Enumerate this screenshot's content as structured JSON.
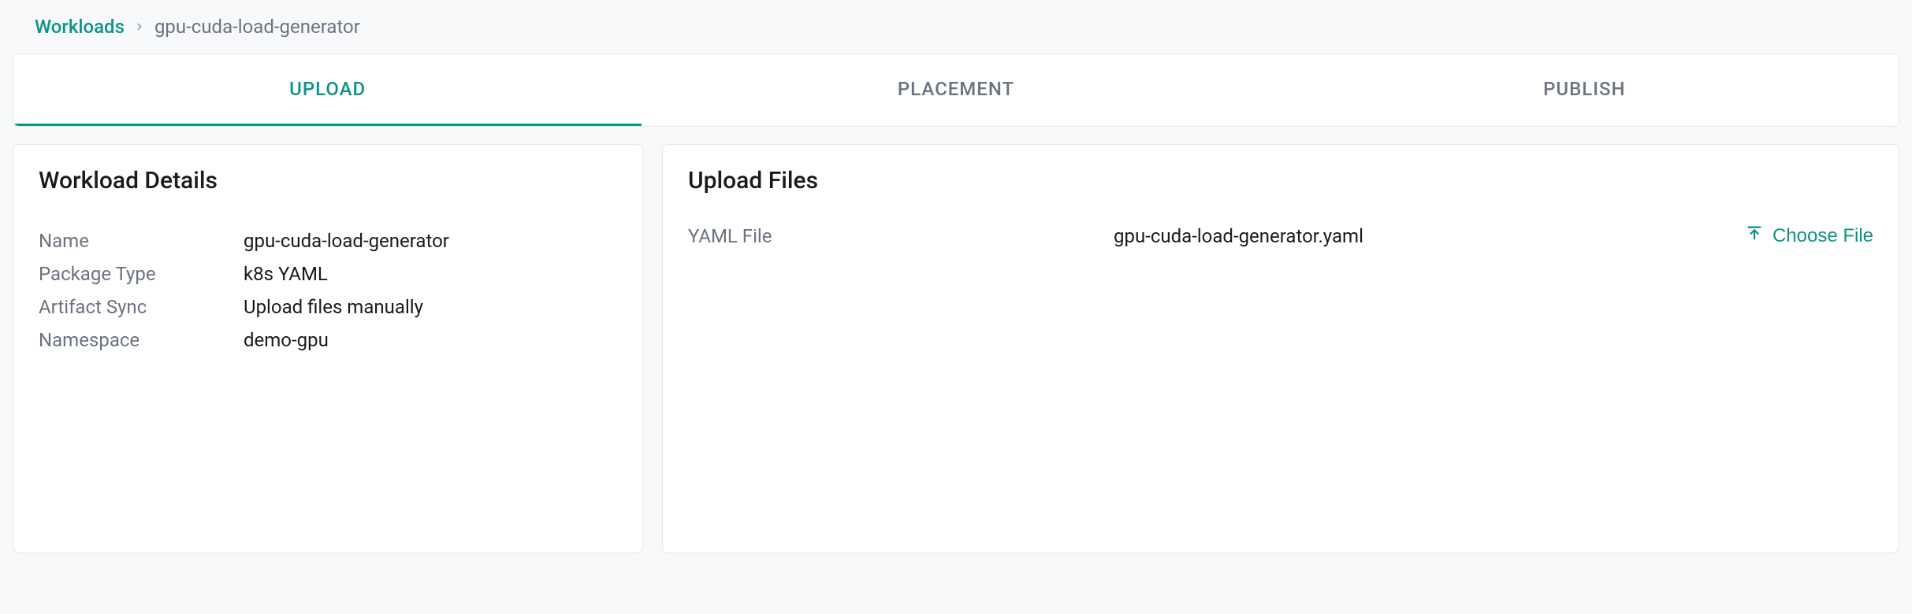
{
  "breadcrumb": {
    "root": "Workloads",
    "current": "gpu-cuda-load-generator"
  },
  "tabs": {
    "upload": "UPLOAD",
    "placement": "PLACEMENT",
    "publish": "PUBLISH"
  },
  "details": {
    "title": "Workload Details",
    "rows": {
      "name": {
        "label": "Name",
        "value": "gpu-cuda-load-generator"
      },
      "packageType": {
        "label": "Package Type",
        "value": "k8s YAML"
      },
      "artifactSync": {
        "label": "Artifact Sync",
        "value": "Upload files manually"
      },
      "namespace": {
        "label": "Namespace",
        "value": "demo-gpu"
      }
    }
  },
  "upload": {
    "title": "Upload Files",
    "label": "YAML File",
    "filename": "gpu-cuda-load-generator.yaml",
    "chooseFile": "Choose File"
  }
}
